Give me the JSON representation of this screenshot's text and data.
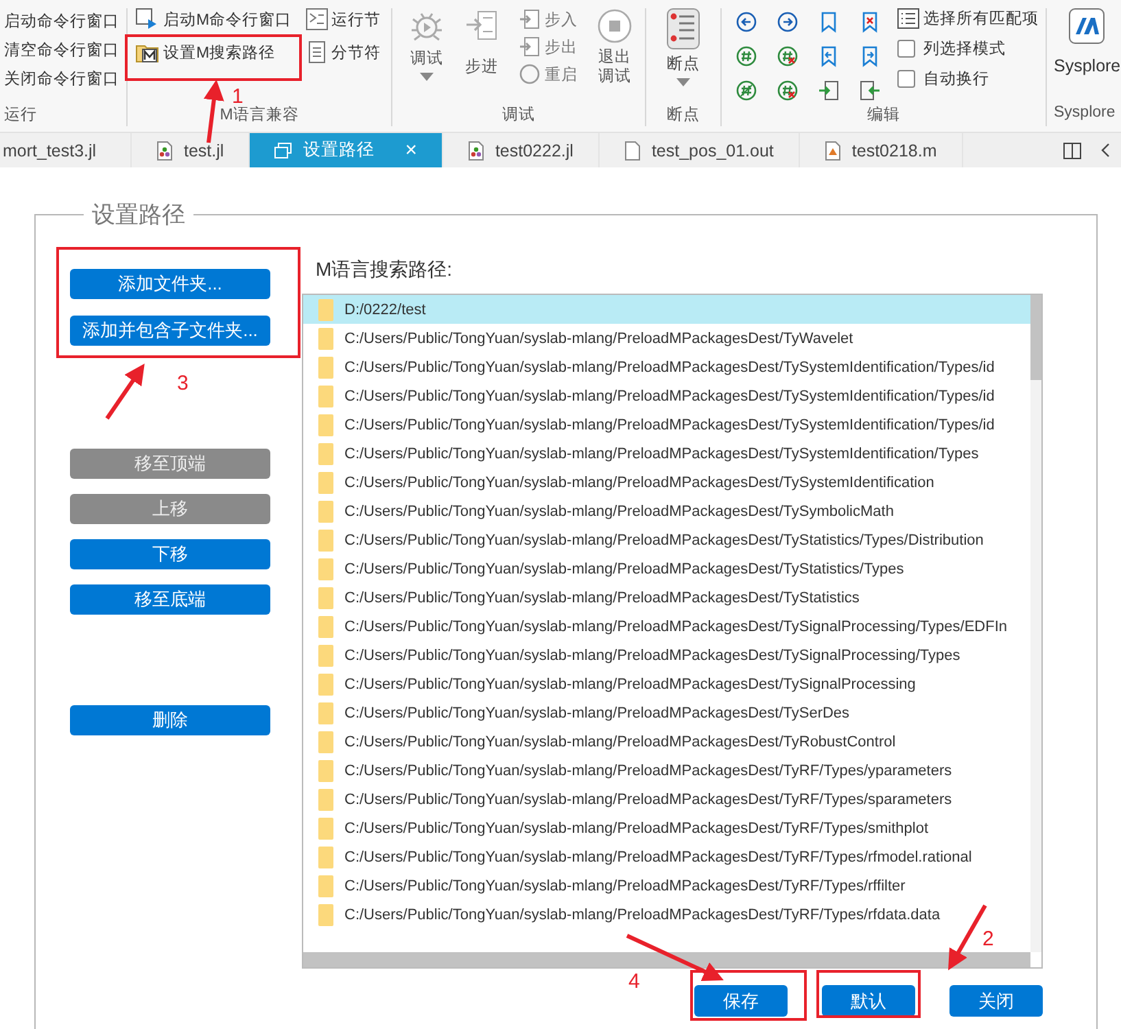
{
  "ribbon": {
    "run_group": {
      "items": [
        "启动命令行窗口",
        "清空命令行窗口",
        "关闭命令行窗口"
      ],
      "label": "运行"
    },
    "m_group": {
      "items": [
        {
          "kind": "launch",
          "label": "启动M命令行窗口"
        },
        {
          "kind": "path",
          "label": "设置M搜索路径"
        },
        {
          "kind": "run-section",
          "label": "运行节"
        },
        {
          "kind": "section-break",
          "label": "分节符"
        }
      ],
      "label": "M语言兼容"
    },
    "debug_group": {
      "debug": "调试",
      "step": "步进",
      "small": [
        "步入",
        "步出",
        "重启"
      ],
      "exit": "退出调试",
      "label": "调试"
    },
    "breakpoint_group": {
      "breakpoint": "断点",
      "label": "断点"
    },
    "edit_group": {
      "select_all": "选择所有匹配项",
      "checks": [
        {
          "label": "列选择模式",
          "checked": false
        },
        {
          "label": "自动换行",
          "checked": false
        }
      ],
      "label": "编辑"
    },
    "sysplore_group": {
      "button": "Sysplore",
      "label": "Sysplore"
    }
  },
  "tabs": [
    {
      "label": "mort_test3.jl",
      "kind": "none",
      "selected": false
    },
    {
      "label": "test.jl",
      "kind": "julia",
      "selected": false
    },
    {
      "label": "设置路径",
      "kind": "dialog",
      "selected": true,
      "close": "×"
    },
    {
      "label": "test0222.jl",
      "kind": "julia",
      "selected": false
    },
    {
      "label": "test_pos_01.out",
      "kind": "text",
      "selected": false
    },
    {
      "label": "test0218.m",
      "kind": "matlab",
      "selected": false
    }
  ],
  "panel": {
    "title": "设置路径",
    "add_buttons": [
      "添加文件夹...",
      "添加并包含子文件夹..."
    ],
    "move_buttons": [
      {
        "label": "移至顶端",
        "disabled": true
      },
      {
        "label": "上移",
        "disabled": true
      },
      {
        "label": "下移",
        "disabled": false
      },
      {
        "label": "移至底端",
        "disabled": false
      }
    ],
    "delete_button": "删除",
    "list_title": "M语言搜索路径:",
    "paths": [
      {
        "text": "D:/0222/test",
        "selected": true
      },
      {
        "text": "C:/Users/Public/TongYuan/syslab-mlang/PreloadMPackagesDest/TyWavelet",
        "selected": false
      },
      {
        "text": "C:/Users/Public/TongYuan/syslab-mlang/PreloadMPackagesDest/TySystemIdentification/Types/id",
        "selected": false
      },
      {
        "text": "C:/Users/Public/TongYuan/syslab-mlang/PreloadMPackagesDest/TySystemIdentification/Types/id",
        "selected": false
      },
      {
        "text": "C:/Users/Public/TongYuan/syslab-mlang/PreloadMPackagesDest/TySystemIdentification/Types/id",
        "selected": false
      },
      {
        "text": "C:/Users/Public/TongYuan/syslab-mlang/PreloadMPackagesDest/TySystemIdentification/Types",
        "selected": false
      },
      {
        "text": "C:/Users/Public/TongYuan/syslab-mlang/PreloadMPackagesDest/TySystemIdentification",
        "selected": false
      },
      {
        "text": "C:/Users/Public/TongYuan/syslab-mlang/PreloadMPackagesDest/TySymbolicMath",
        "selected": false
      },
      {
        "text": "C:/Users/Public/TongYuan/syslab-mlang/PreloadMPackagesDest/TyStatistics/Types/Distribution",
        "selected": false
      },
      {
        "text": "C:/Users/Public/TongYuan/syslab-mlang/PreloadMPackagesDest/TyStatistics/Types",
        "selected": false
      },
      {
        "text": "C:/Users/Public/TongYuan/syslab-mlang/PreloadMPackagesDest/TyStatistics",
        "selected": false
      },
      {
        "text": "C:/Users/Public/TongYuan/syslab-mlang/PreloadMPackagesDest/TySignalProcessing/Types/EDFIn",
        "selected": false
      },
      {
        "text": "C:/Users/Public/TongYuan/syslab-mlang/PreloadMPackagesDest/TySignalProcessing/Types",
        "selected": false
      },
      {
        "text": "C:/Users/Public/TongYuan/syslab-mlang/PreloadMPackagesDest/TySignalProcessing",
        "selected": false
      },
      {
        "text": "C:/Users/Public/TongYuan/syslab-mlang/PreloadMPackagesDest/TySerDes",
        "selected": false
      },
      {
        "text": "C:/Users/Public/TongYuan/syslab-mlang/PreloadMPackagesDest/TyRobustControl",
        "selected": false
      },
      {
        "text": "C:/Users/Public/TongYuan/syslab-mlang/PreloadMPackagesDest/TyRF/Types/yparameters",
        "selected": false
      },
      {
        "text": "C:/Users/Public/TongYuan/syslab-mlang/PreloadMPackagesDest/TyRF/Types/sparameters",
        "selected": false
      },
      {
        "text": "C:/Users/Public/TongYuan/syslab-mlang/PreloadMPackagesDest/TyRF/Types/smithplot",
        "selected": false
      },
      {
        "text": "C:/Users/Public/TongYuan/syslab-mlang/PreloadMPackagesDest/TyRF/Types/rfmodel.rational",
        "selected": false
      },
      {
        "text": "C:/Users/Public/TongYuan/syslab-mlang/PreloadMPackagesDest/TyRF/Types/rffilter",
        "selected": false
      },
      {
        "text": "C:/Users/Public/TongYuan/syslab-mlang/PreloadMPackagesDest/TyRF/Types/rfdata.data",
        "selected": false
      }
    ],
    "bottom_buttons": [
      "保存",
      "默认",
      "关闭"
    ]
  },
  "annotations": [
    "1",
    "3",
    "4",
    "2"
  ]
}
